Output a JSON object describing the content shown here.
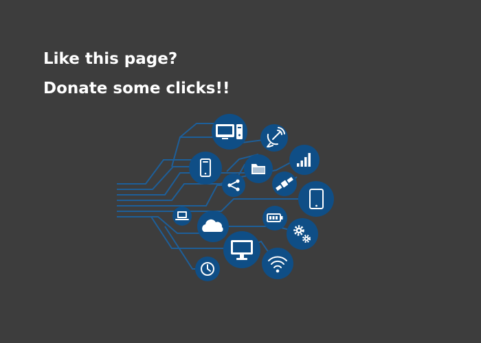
{
  "promo": {
    "line1": "Like this page?",
    "line2": "Donate some clicks!!"
  },
  "colors": {
    "background": "#3d3d3d",
    "node_fill": "#0f4e86",
    "wire": "#1d5f9a",
    "icon": "#ffffff"
  },
  "icons": [
    "desktop-computer-icon",
    "satellite-dish-icon",
    "signal-bars-icon",
    "smartphone-icon",
    "folder-icon",
    "share-icon",
    "satellite-icon",
    "tablet-icon",
    "laptop-icon",
    "cloud-icon",
    "battery-icon",
    "gears-icon",
    "monitor-icon",
    "clock-icon",
    "wifi-icon"
  ]
}
